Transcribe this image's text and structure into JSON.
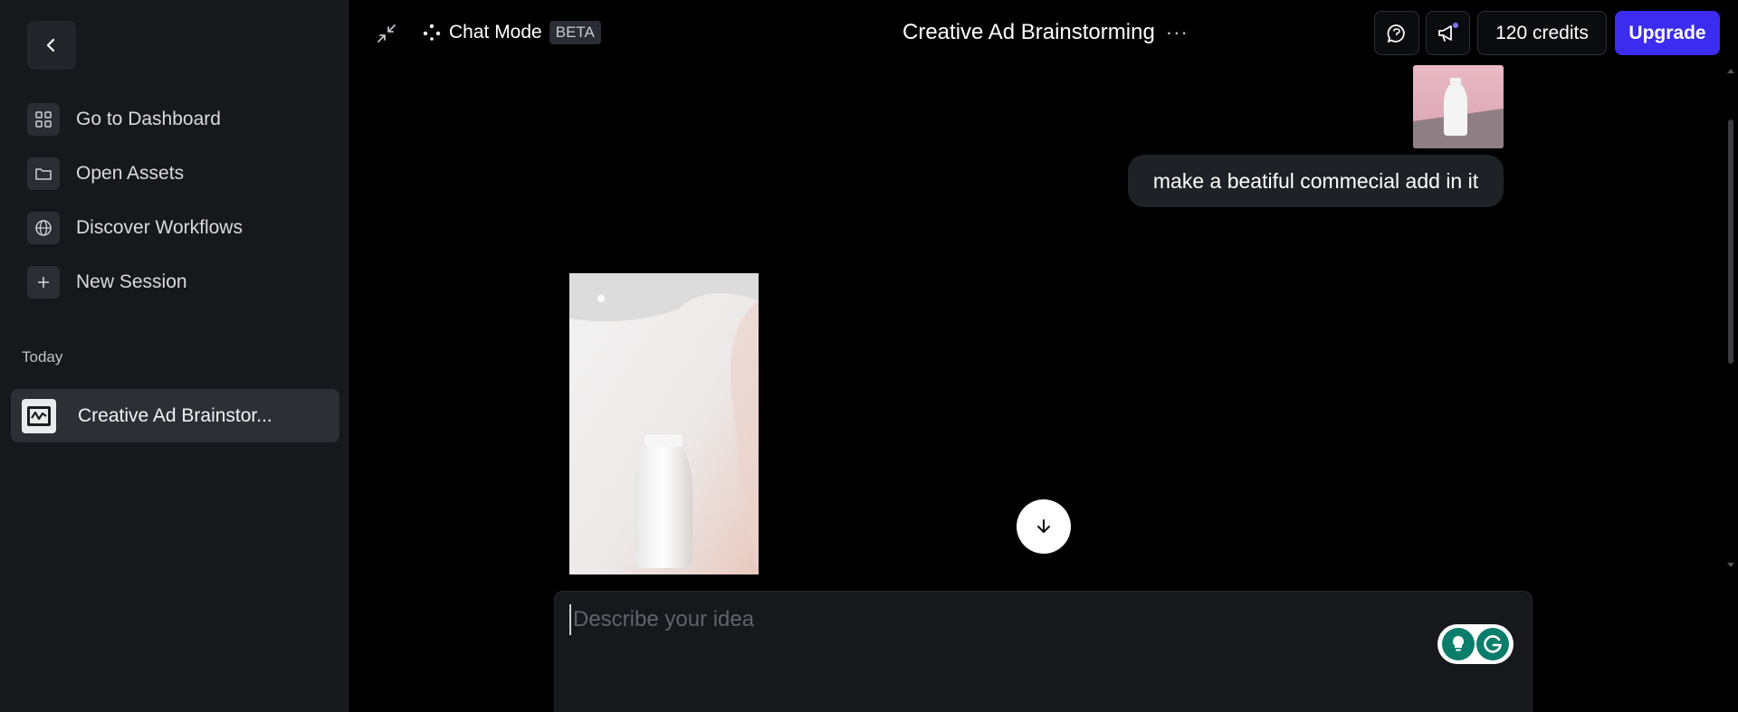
{
  "sidebar": {
    "back_icon": "chevron-left-icon",
    "items": [
      {
        "label": "Go to Dashboard",
        "icon": "grid-icon"
      },
      {
        "label": "Open Assets",
        "icon": "folder-icon"
      },
      {
        "label": "Discover Workflows",
        "icon": "globe-icon"
      },
      {
        "label": "New Session",
        "icon": "plus-icon"
      }
    ],
    "section_label": "Today",
    "sessions": [
      {
        "label": "Creative Ad Brainstor...",
        "icon": "session-chart-icon"
      }
    ]
  },
  "header": {
    "mode_label": "Chat Mode",
    "mode_badge": "BETA",
    "title": "Creative Ad Brainstorming",
    "more_glyph": "···",
    "credits_label": "120 credits",
    "upgrade_label": "Upgrade"
  },
  "chat": {
    "user_message": "make a beatiful commecial add in it"
  },
  "composer": {
    "placeholder": "Describe your idea",
    "value": ""
  },
  "colors": {
    "accent": "#3b2cf0",
    "sidebar_bg": "#16181c",
    "page_bg": "#000000"
  }
}
